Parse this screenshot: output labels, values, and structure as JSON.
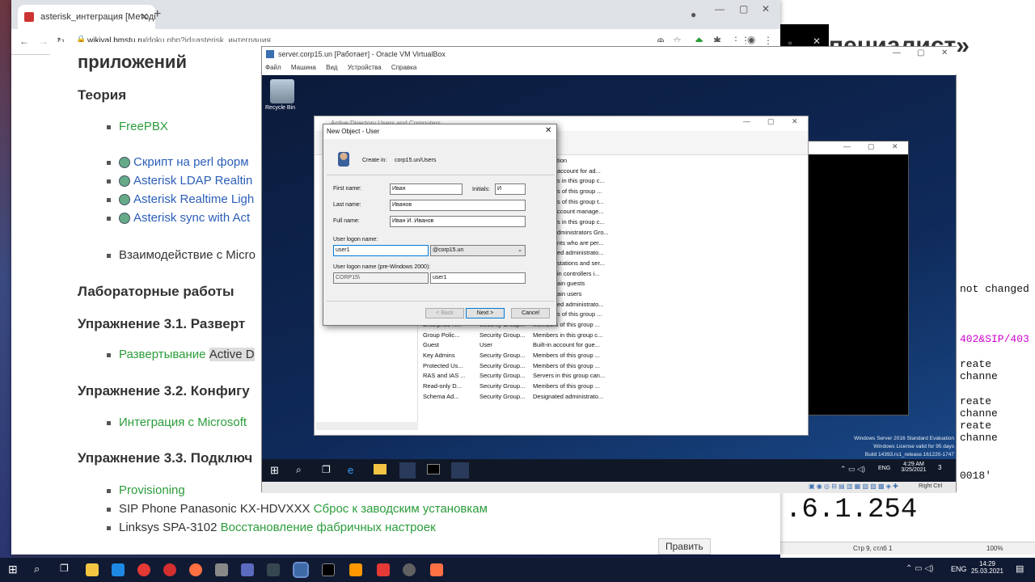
{
  "browser": {
    "tab_title": "asterisk_интеграция [Методич",
    "url_domain": "wikival.bmstu.ru",
    "url_path": "/doku.php?id=asterisk_интеграция"
  },
  "page": {
    "heading_partial": "приложений",
    "theory_heading": "Теория",
    "theory_items": [
      "FreePBX"
    ],
    "script_items": [
      "Скрипт на perl форм",
      "Asterisk LDAP Realtin",
      "Asterisk Realtime Ligh",
      "Asterisk sync with Act"
    ],
    "interaction_item": "Взаимодействие с Micro",
    "labs_heading": "Лабораторные работы",
    "ex31_heading": "Упражнение 3.1. Разверт",
    "ex31_item_link": "Развертывание",
    "ex31_item_text": "Active D",
    "ex32_heading": "Упражнение 3.2. Конфигу",
    "ex32_item": "Интеграция с Microsoft",
    "ex33_heading": "Упражнение 3.3. Подключ",
    "ex33_items": [
      {
        "text": "",
        "link": "Provisioning"
      },
      {
        "text": "SIP Phone Panasonic KX-HDVXXX",
        "link": "Сброс к заводским установкам"
      },
      {
        "text": "Linksys SPA-3102",
        "link": "Восстановление фабричных настроек"
      }
    ],
    "edit_button": "Править"
  },
  "right_panel": {
    "title_partial": "пециалист»",
    "lines": [
      "not changed",
      "402&SIP/403",
      "reate channe",
      "reate channe",
      "reate channe",
      "0018'"
    ],
    "big_text": ".6.1.254",
    "status_pos": "Стр 9, стлб 1",
    "status_zoom": "100%"
  },
  "vbox": {
    "title": "server.corp15.un [Работает] - Oracle VM VirtualBox",
    "menu": [
      "Файл",
      "Машина",
      "Вид",
      "Устройства",
      "Справка"
    ],
    "host_key": "Right Ctrl"
  },
  "guest": {
    "recycle_bin": "Recycle Bin",
    "ad_title": "Active Directory Users and Computers",
    "watermark": [
      "Windows Server 2016 Standard Evaluation",
      "Windows License valid for 95 days",
      "Build 14393.rs1_release.161220-1747"
    ],
    "clock_time": "4:29 AM",
    "clock_date": "3/25/2021",
    "lang": "ENG",
    "notif_count": "3",
    "ad_desc_top": [
      "tion",
      "account for ad...",
      "s in this group c...",
      "s of this group ...",
      "s of this group t...",
      "ccount manage...",
      "s in this group c...",
      "dministrators Gro...",
      "nts who are per...",
      "ed administrato...",
      "stations and ser...",
      "in controllers i...",
      "ain guests",
      "ain users",
      "ed administrato...",
      "s of this group ..."
    ],
    "ad_rows": [
      {
        "name": "Enterprise R...",
        "type": "Security Group...",
        "desc": "Members of this group ..."
      },
      {
        "name": "Group Polic...",
        "type": "Security Group...",
        "desc": "Members in this group c..."
      },
      {
        "name": "Guest",
        "type": "User",
        "desc": "Built-in account for gue..."
      },
      {
        "name": "Key Admins",
        "type": "Security Group...",
        "desc": "Members of this group ..."
      },
      {
        "name": "Protected Us...",
        "type": "Security Group...",
        "desc": "Members of this group ..."
      },
      {
        "name": "RAS and IAS ...",
        "type": "Security Group...",
        "desc": "Servers in this group can..."
      },
      {
        "name": "Read-only D...",
        "type": "Security Group...",
        "desc": "Members of this group ..."
      },
      {
        "name": "Schema Ad...",
        "type": "Security Group...",
        "desc": "Designated administrato..."
      }
    ]
  },
  "dialog": {
    "title": "New Object - User",
    "create_in_label": "Create in:",
    "create_in_value": "corp15.un/Users",
    "first_name_label": "First name:",
    "first_name": "Иван",
    "initials_label": "Initials:",
    "initials": "И",
    "last_name_label": "Last name:",
    "last_name": "Иванов",
    "full_name_label": "Full name:",
    "full_name": "Иван И. Иванов",
    "logon_label": "User logon name:",
    "logon": "user1",
    "domain": "@corp15.un",
    "pre2000_label": "User logon name (pre-Windows 2000):",
    "pre2000_domain": "CORP15\\",
    "pre2000_user": "user1",
    "back": "< Back",
    "next": "Next >",
    "cancel": "Cancel"
  },
  "host_taskbar": {
    "lang": "ENG",
    "time": "14:29",
    "date": "25.03.2021"
  },
  "colors": {
    "link_green": "#2a9d3a",
    "link_blue": "#2b5eb8",
    "guest_bg": "#0f2a5a"
  }
}
